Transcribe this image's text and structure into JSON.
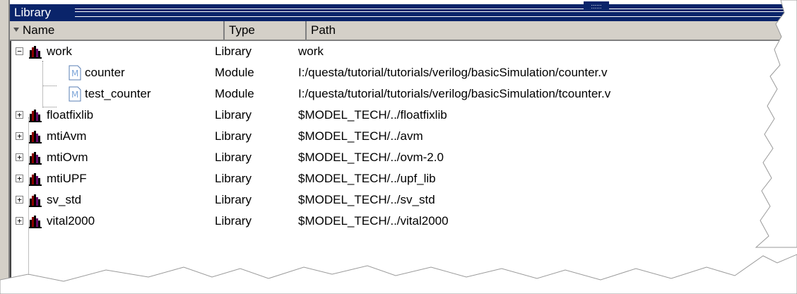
{
  "window": {
    "title": "Library",
    "grip_dots": "::::::"
  },
  "columns": {
    "name": "Name",
    "type": "Type",
    "path": "Path"
  },
  "rows": [
    {
      "name": "work",
      "type": "Library",
      "path": "work",
      "icon": "library-icon",
      "expander": "−",
      "level": 0
    },
    {
      "name": "counter",
      "type": "Module",
      "path": "I:/questa/tutorial/tutorials/verilog/basicSimulation/counter.v",
      "icon": "module-icon",
      "level": 1
    },
    {
      "name": "test_counter",
      "type": "Module",
      "path": "I:/questa/tutorial/tutorials/verilog/basicSimulation/tcounter.v",
      "icon": "module-icon",
      "level": 1
    },
    {
      "name": "floatfixlib",
      "type": "Library",
      "path": "$MODEL_TECH/../floatfixlib",
      "icon": "library-icon",
      "expander": "+",
      "level": 0
    },
    {
      "name": "mtiAvm",
      "type": "Library",
      "path": "$MODEL_TECH/../avm",
      "icon": "library-icon",
      "expander": "+",
      "level": 0
    },
    {
      "name": "mtiOvm",
      "type": "Library",
      "path": "$MODEL_TECH/../ovm-2.0",
      "icon": "library-icon",
      "expander": "+",
      "level": 0
    },
    {
      "name": "mtiUPF",
      "type": "Library",
      "path": "$MODEL_TECH/../upf_lib",
      "icon": "library-icon",
      "expander": "+",
      "level": 0
    },
    {
      "name": "sv_std",
      "type": "Library",
      "path": "$MODEL_TECH/../sv_std",
      "icon": "library-icon",
      "expander": "+",
      "level": 0
    },
    {
      "name": "vital2000",
      "type": "Library",
      "path": "$MODEL_TECH/../vital2000",
      "icon": "library-icon",
      "expander": "+",
      "level": 0
    }
  ],
  "colors": {
    "title_bar": "#0a246a",
    "header_bg": "#d4d0c8",
    "module_icon": "#7fa7d9"
  }
}
